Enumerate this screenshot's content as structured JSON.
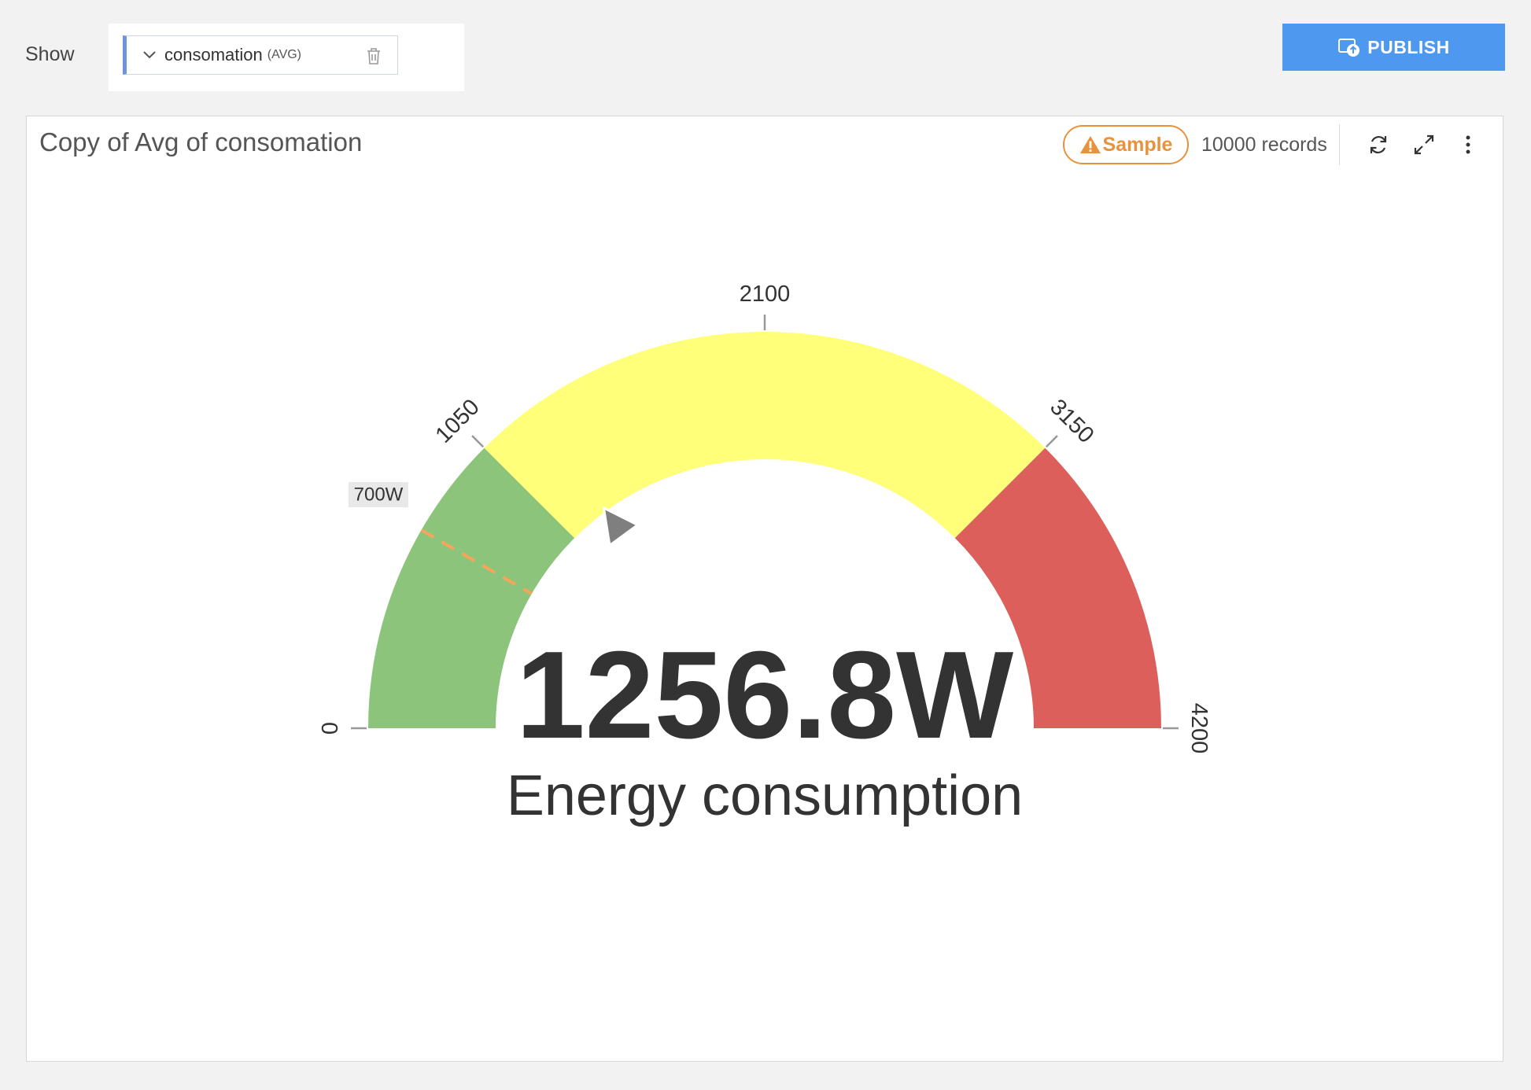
{
  "toolbar": {
    "show_label": "Show",
    "measure": {
      "name": "consomation",
      "aggregation": "(AVG)",
      "chevron_icon": "chevron-down-icon",
      "delete_icon": "trash-icon"
    },
    "publish_label": "PUBLISH",
    "publish_icon": "publish-icon"
  },
  "card": {
    "title": "Copy of Avg of consomation",
    "sample_label": "Sample",
    "sample_icon": "warning-icon",
    "records_label": "10000 records",
    "refresh_icon": "refresh-icon",
    "expand_icon": "expand-icon",
    "menu_icon": "more-vertical-icon"
  },
  "chart_data": {
    "type": "gauge",
    "min": 0,
    "max": 4200,
    "value": 1256.8,
    "value_label": "1256.8W",
    "label": "Energy consumption",
    "ticks": [
      0,
      1050,
      2100,
      3150,
      4200
    ],
    "tick_labels": [
      "0",
      "1050",
      "2100",
      "3150",
      "4200"
    ],
    "bands": [
      {
        "from": 0,
        "to": 1050,
        "color": "#8cc47c"
      },
      {
        "from": 1050,
        "to": 3150,
        "color": "#ffff7a"
      },
      {
        "from": 3150,
        "to": 4200,
        "color": "#dc5f5b"
      }
    ],
    "target": {
      "value": 700,
      "label": "700W",
      "color": "#f5a65b"
    },
    "pointer_color": "#7f7f7f"
  }
}
